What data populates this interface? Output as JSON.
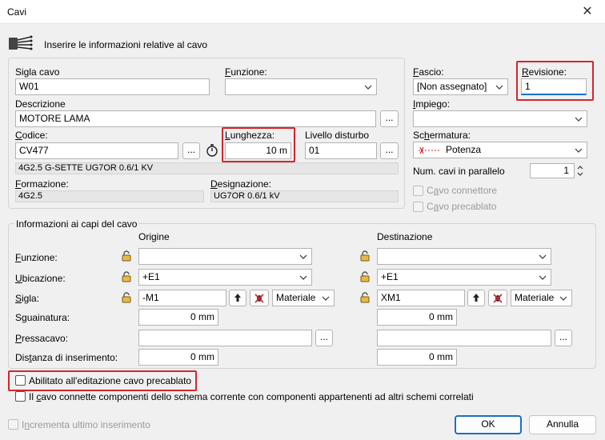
{
  "window": {
    "title": "Cavi"
  },
  "header": {
    "text": "Inserire le informazioni relative al cavo"
  },
  "cable": {
    "sigla_label": "Sigla cavo",
    "sigla_value": "W01",
    "funzione_label": "Funzione:",
    "funzione_value": "",
    "descrizione_label": "Descrizione",
    "descrizione_value": "MOTORE LAMA",
    "codice_label": "Codice:",
    "codice_value": "CV477",
    "lunghezza_label": "Lunghezza:",
    "lunghezza_value": "10 m",
    "livello_label": "Livello disturbo",
    "livello_value": "01",
    "code_desc": "4G2.5 G-SETTE UG7OR 0.6/1 KV",
    "formazione_label": "Formazione:",
    "formazione_value": "4G2.5",
    "designazione_label": "Designazione:",
    "designazione_value": "UG7OR 0.6/1 kV",
    "ellipsis": "..."
  },
  "right": {
    "fascio_label": "Fascio:",
    "fascio_value": "[Non assegnato]",
    "revisione_label": "Revisione:",
    "revisione_value": "1",
    "impiego_label": "Impiego:",
    "impiego_value": "",
    "schermatura_label": "Schermatura:",
    "schermatura_value": "Potenza",
    "num_cavi_label": "Num. cavi in parallelo",
    "num_cavi_value": "1",
    "cavo_connettore_label": "Cavo connettore",
    "cavo_precablato_label": "Cavo precablato"
  },
  "ends": {
    "group_title": "Informazioni ai capi del cavo",
    "origine_label": "Origine",
    "destinazione_label": "Destinazione",
    "funzione_label": "Funzione:",
    "ubicazione_label": "Ubicazione:",
    "sigla_label": "Sigla:",
    "sguainatura_label": "Sguainatura:",
    "pressacavo_label": "Pressacavo:",
    "distanza_label": "Distanza di inserimento:",
    "origine": {
      "funzione": "",
      "ubicazione": "+E1",
      "sigla": "-M1",
      "tipo": "Materiale",
      "sguainatura": "0 mm",
      "pressacavo": "",
      "distanza": "0 mm"
    },
    "destinazione": {
      "funzione": "",
      "ubicazione": "+E1",
      "sigla": "XM1",
      "tipo": "Materiale",
      "sguainatura": "0 mm",
      "pressacavo": "",
      "distanza": "0 mm"
    }
  },
  "options": {
    "abilitato_label": "Abilitato all'editazione cavo precablato",
    "connette_label": "Il cavo connette componenti dello schema corrente con componenti appartenenti ad altri schemi correlati"
  },
  "footer": {
    "incrementa_label": "Incrementa ultimo inserimento",
    "ok_label": "OK",
    "annulla_label": "Annulla"
  },
  "colors": {
    "highlight_red": "#d6252b",
    "focus_blue": "#1a6fc9"
  }
}
